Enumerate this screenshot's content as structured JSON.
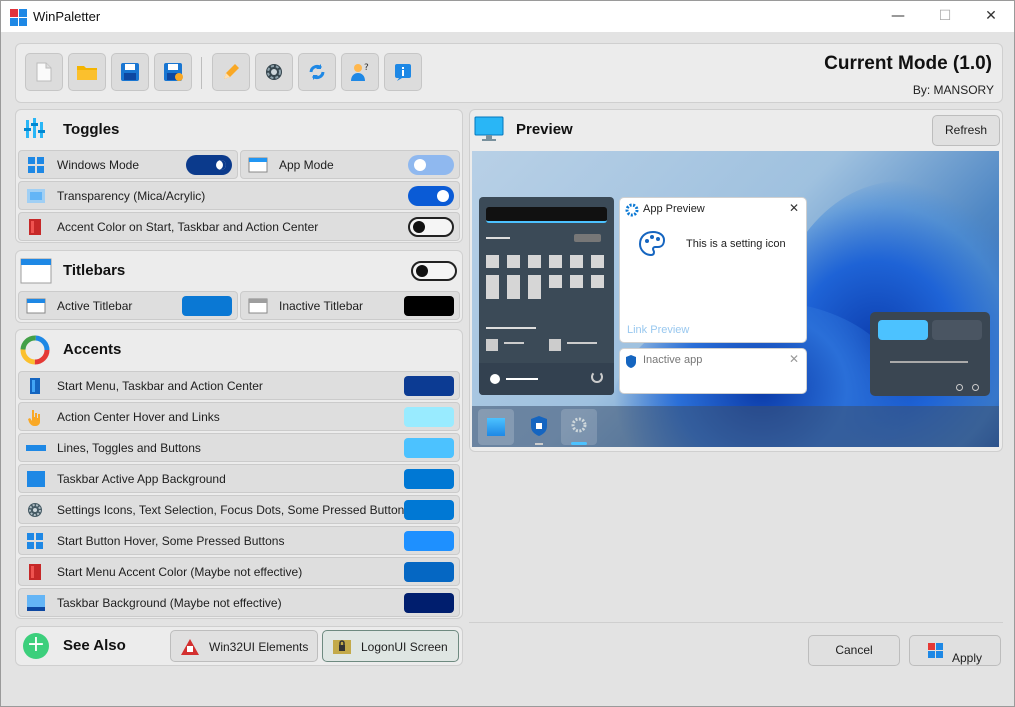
{
  "window": {
    "title": "WinPaletter",
    "controls": {
      "minimize": "—",
      "maximize": "☐",
      "close": "✕"
    }
  },
  "header": {
    "mode_title": "Current Mode (1.0)",
    "author": "By: MANSORY",
    "toolbar_icons": [
      "new-file-icon",
      "open-folder-icon",
      "save-icon",
      "save-as-icon",
      "edit-pencil-icon",
      "settings-gear-icon",
      "refresh-icon",
      "user-help-icon",
      "info-icon"
    ]
  },
  "toggles": {
    "heading": "Toggles",
    "windows_mode": {
      "label": "Windows Mode",
      "state": "dark"
    },
    "app_mode": {
      "label": "App Mode",
      "state": "light"
    },
    "transparency": {
      "label": "Transparency (Mica/Acrylic)",
      "on": true
    },
    "accent_on_start": {
      "label": "Accent Color on Start, Taskbar and Action Center",
      "on": false
    }
  },
  "titlebars": {
    "heading": "Titlebars",
    "on": false,
    "active": {
      "label": "Active Titlebar",
      "color": "#0a78d4"
    },
    "inactive": {
      "label": "Inactive Titlebar",
      "color": "#000000"
    }
  },
  "accents": {
    "heading": "Accents",
    "items": [
      {
        "label": "Start Menu, Taskbar and Action Center",
        "color": "#0c3b93",
        "icon": "start-menu-icon"
      },
      {
        "label": "Action Center Hover and Links",
        "color": "#99ebff",
        "icon": "hand-pointer-icon"
      },
      {
        "label": "Lines, Toggles and Buttons",
        "color": "#4cc2ff",
        "icon": "lines-icon"
      },
      {
        "label": "Taskbar Active App Background",
        "color": "#0078d4",
        "icon": "taskbar-app-icon"
      },
      {
        "label": "Settings Icons, Text Selection, Focus Dots, Some Pressed Buttons",
        "color": "#0078d4",
        "icon": "settings-icon"
      },
      {
        "label": "Start Button Hover, Some Pressed Buttons",
        "color": "#1e90ff",
        "icon": "windows-logo-icon"
      },
      {
        "label": "Start Menu Accent Color (Maybe not effective)",
        "color": "#0567c3",
        "icon": "book-icon"
      },
      {
        "label": "Taskbar Background (Maybe not effective)",
        "color": "#001e6e",
        "icon": "taskbar-icon"
      }
    ]
  },
  "see_also": {
    "heading": "See Also",
    "win32": "Win32UI Elements",
    "logon": "LogonUI Screen"
  },
  "preview": {
    "heading": "Preview",
    "refresh": "Refresh",
    "app_preview_title": "App Preview",
    "setting_text": "This is a setting icon",
    "link_text": "Link Preview",
    "inactive_app": "Inactive app",
    "close_glyph": "✕"
  },
  "footer": {
    "cancel": "Cancel",
    "apply": "Apply"
  }
}
